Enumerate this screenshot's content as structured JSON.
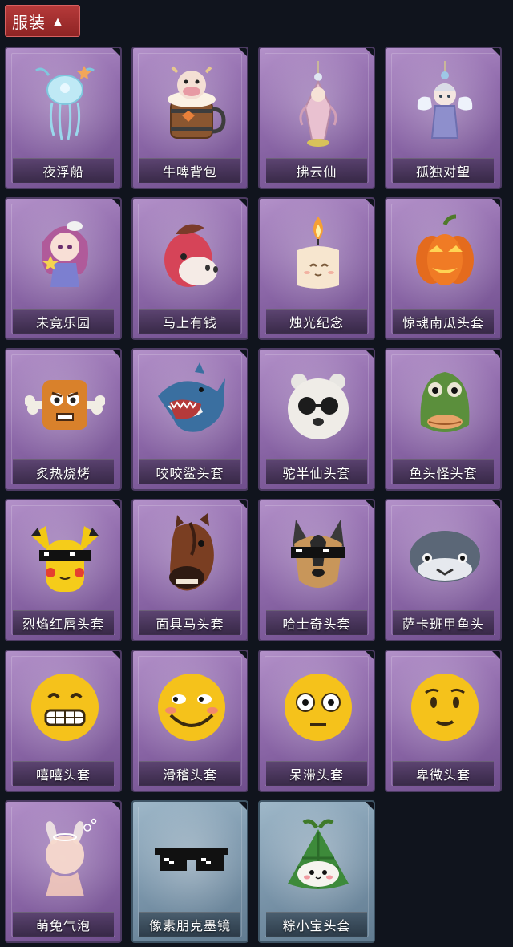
{
  "header": {
    "tab_label": "服装"
  },
  "colors": {
    "background": "#10141d",
    "tab_red": "#a42f2f",
    "rarity_purple": "#8f6aab",
    "rarity_blue": "#7d98ad"
  },
  "items": [
    {
      "name": "夜浮船",
      "rarity": "purple",
      "icon": "jellyfish-icon"
    },
    {
      "name": "牛啤背包",
      "rarity": "purple",
      "icon": "cow-beer-barrel-icon"
    },
    {
      "name": "拂云仙",
      "rarity": "purple",
      "icon": "fairy-pendant-icon"
    },
    {
      "name": "孤独对望",
      "rarity": "purple",
      "icon": "angel-pendant-icon"
    },
    {
      "name": "未竟乐园",
      "rarity": "purple",
      "icon": "girl-doll-icon"
    },
    {
      "name": "马上有钱",
      "rarity": "purple",
      "icon": "pink-horse-head-icon"
    },
    {
      "name": "烛光纪念",
      "rarity": "purple",
      "icon": "candle-icon"
    },
    {
      "name": "惊魂南瓜头套",
      "rarity": "purple",
      "icon": "pumpkin-icon"
    },
    {
      "name": "炙热烧烤",
      "rarity": "purple",
      "icon": "meat-bone-icon"
    },
    {
      "name": "咬咬鲨头套",
      "rarity": "purple",
      "icon": "shark-icon"
    },
    {
      "name": "驼半仙头套",
      "rarity": "purple",
      "icon": "bear-sunglasses-icon"
    },
    {
      "name": "鱼头怪头套",
      "rarity": "purple",
      "icon": "fish-head-icon"
    },
    {
      "name": "烈焰红唇头套",
      "rarity": "purple",
      "icon": "yellow-mouse-sunglasses-icon"
    },
    {
      "name": "面具马头套",
      "rarity": "purple",
      "icon": "horse-head-icon"
    },
    {
      "name": "哈士奇头套",
      "rarity": "purple",
      "icon": "husky-sunglasses-icon"
    },
    {
      "name": "萨卡班甲鱼头",
      "rarity": "purple",
      "icon": "round-fish-icon"
    },
    {
      "name": "嘻嘻头套",
      "rarity": "purple",
      "icon": "grin-emoji-icon"
    },
    {
      "name": "滑稽头套",
      "rarity": "purple",
      "icon": "funny-emoji-icon"
    },
    {
      "name": "呆滞头套",
      "rarity": "purple",
      "icon": "stare-emoji-icon"
    },
    {
      "name": "卑微头套",
      "rarity": "purple",
      "icon": "humble-emoji-icon"
    },
    {
      "name": "萌兔气泡",
      "rarity": "purple",
      "icon": "bunny-bubble-icon"
    },
    {
      "name": "像素朋克墨镜",
      "rarity": "blue",
      "icon": "pixel-sunglasses-icon"
    },
    {
      "name": "粽小宝头套",
      "rarity": "blue",
      "icon": "zongzi-icon"
    }
  ]
}
